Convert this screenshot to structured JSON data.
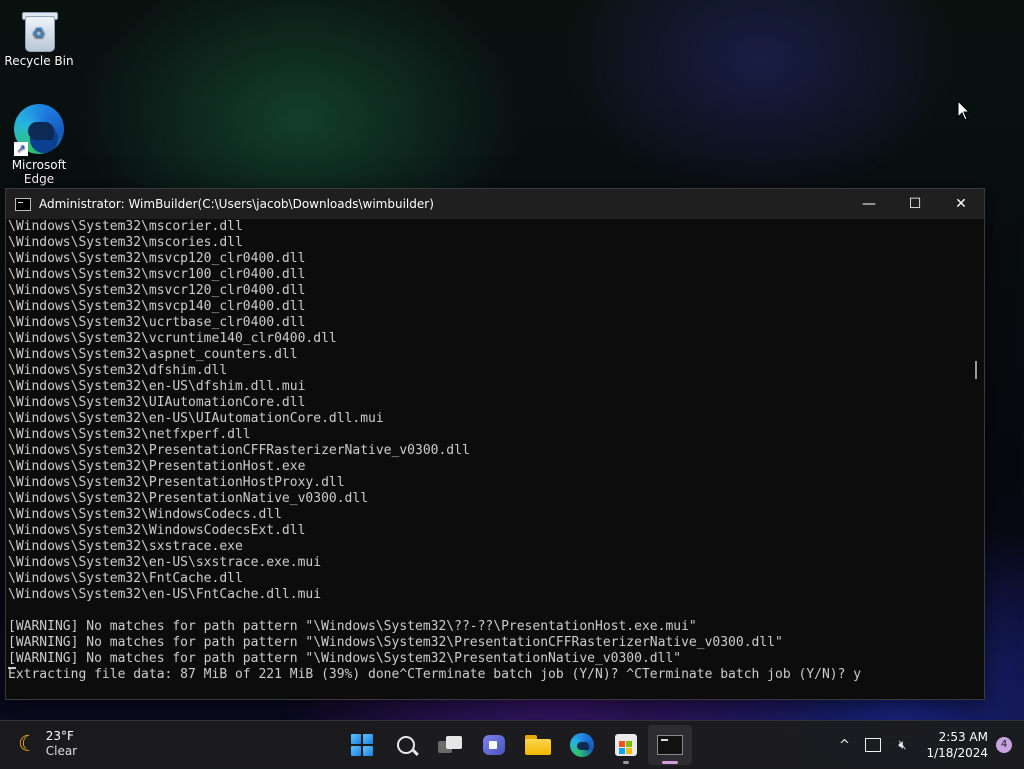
{
  "desktop": {
    "icons": [
      {
        "label": "Recycle Bin",
        "icon": "recycle-bin-icon"
      },
      {
        "label": "Microsoft Edge",
        "icon": "edge-icon"
      }
    ]
  },
  "window": {
    "title": "Administrator:  WimBuilder(C:\\Users\\jacob\\Downloads\\wimbuilder)",
    "controls": {
      "minimize": "—",
      "maximize": "☐",
      "close": "✕"
    }
  },
  "console": {
    "lines": [
      "\\Windows\\System32\\mscorier.dll",
      "\\Windows\\System32\\mscories.dll",
      "\\Windows\\System32\\msvcp120_clr0400.dll",
      "\\Windows\\System32\\msvcr100_clr0400.dll",
      "\\Windows\\System32\\msvcr120_clr0400.dll",
      "\\Windows\\System32\\msvcp140_clr0400.dll",
      "\\Windows\\System32\\ucrtbase_clr0400.dll",
      "\\Windows\\System32\\vcruntime140_clr0400.dll",
      "\\Windows\\System32\\aspnet_counters.dll",
      "\\Windows\\System32\\dfshim.dll",
      "\\Windows\\System32\\en-US\\dfshim.dll.mui",
      "\\Windows\\System32\\UIAutomationCore.dll",
      "\\Windows\\System32\\en-US\\UIAutomationCore.dll.mui",
      "\\Windows\\System32\\netfxperf.dll",
      "\\Windows\\System32\\PresentationCFFRasterizerNative_v0300.dll",
      "\\Windows\\System32\\PresentationHost.exe",
      "\\Windows\\System32\\PresentationHostProxy.dll",
      "\\Windows\\System32\\PresentationNative_v0300.dll",
      "\\Windows\\System32\\WindowsCodecs.dll",
      "\\Windows\\System32\\WindowsCodecsExt.dll",
      "\\Windows\\System32\\sxstrace.exe",
      "\\Windows\\System32\\en-US\\sxstrace.exe.mui",
      "\\Windows\\System32\\FntCache.dll",
      "\\Windows\\System32\\en-US\\FntCache.dll.mui",
      "",
      "[WARNING] No matches for path pattern \"\\Windows\\System32\\??-??\\PresentationHost.exe.mui\"",
      "[WARNING] No matches for path pattern \"\\Windows\\System32\\PresentationCFFRasterizerNative_v0300.dll\"",
      "[WARNING] No matches for path pattern \"\\Windows\\System32\\PresentationNative_v0300.dll\"",
      "Extracting file data: 87 MiB of 221 MiB (39%) done^CTerminate batch job (Y/N)? ^CTerminate batch job (Y/N)? y"
    ]
  },
  "taskbar": {
    "weather": {
      "temp": "23°F",
      "condition": "Clear",
      "icon": "moon-icon"
    },
    "apps": [
      {
        "name": "start",
        "icon": "windows-start-icon"
      },
      {
        "name": "search",
        "icon": "search-icon"
      },
      {
        "name": "task-view",
        "icon": "task-view-icon"
      },
      {
        "name": "chat",
        "icon": "teams-chat-icon"
      },
      {
        "name": "file-explorer",
        "icon": "folder-icon"
      },
      {
        "name": "edge",
        "icon": "edge-icon"
      },
      {
        "name": "store",
        "icon": "store-icon"
      },
      {
        "name": "terminal",
        "icon": "terminal-icon"
      }
    ],
    "tray": {
      "chevron": "^",
      "time": "2:53 AM",
      "date": "1/18/2024",
      "notifications": "4"
    }
  }
}
